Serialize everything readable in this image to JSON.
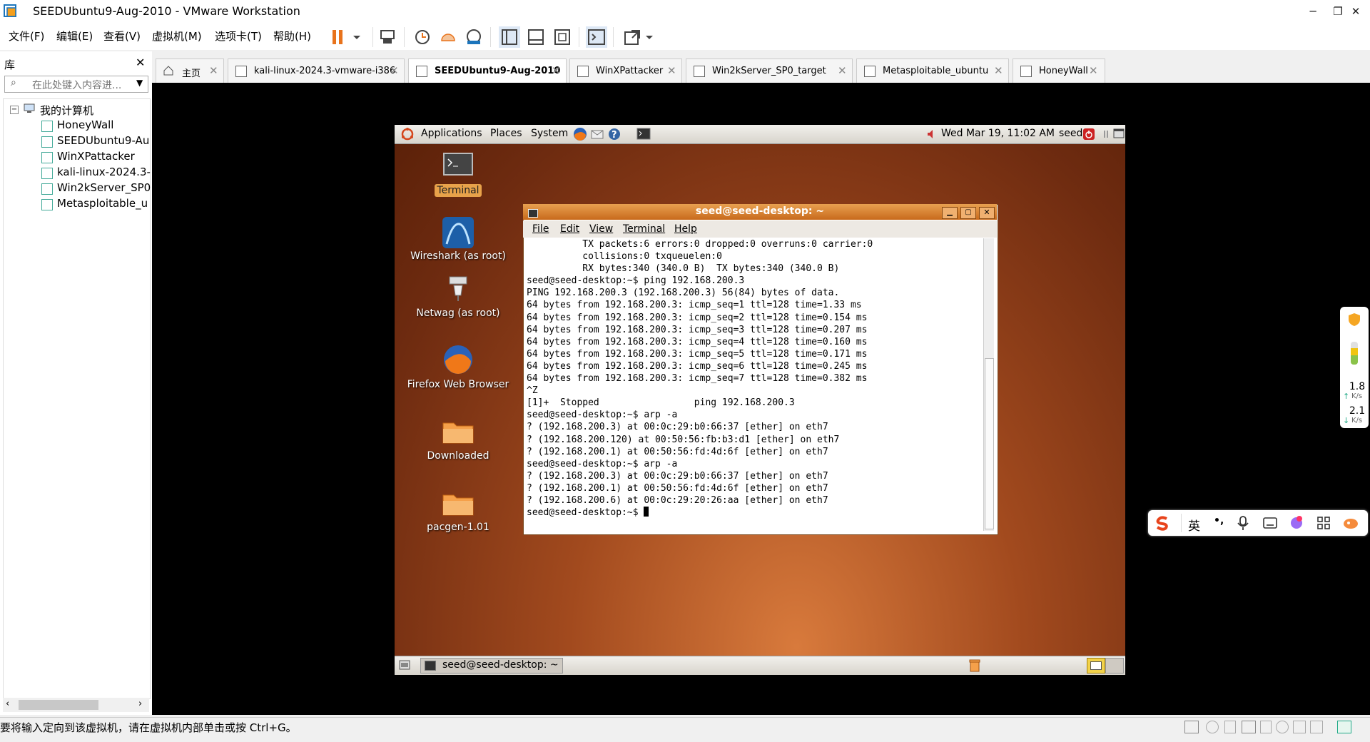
{
  "window": {
    "title": "SEEDUbuntu9-Aug-2010 - VMware Workstation",
    "min": "─",
    "restore": "❐",
    "close": "✕"
  },
  "menubar": {
    "items": [
      "文件(F)",
      "编辑(E)",
      "查看(V)",
      "虚拟机(M)",
      "选项卡(T)",
      "帮助(H)"
    ]
  },
  "library": {
    "title": "库",
    "search_placeholder": "在此处键入内容进...",
    "root": "我的计算机",
    "items": [
      "HoneyWall",
      "SEEDUbuntu9-Au",
      "WinXPattacker",
      "kali-linux-2024.3-",
      "Win2kServer_SP0",
      "Metasploitable_u"
    ]
  },
  "tabs": [
    {
      "label": "主页"
    },
    {
      "label": "kali-linux-2024.3-vmware-i386"
    },
    {
      "label": "SEEDUbuntu9-Aug-2010"
    },
    {
      "label": "WinXPattacker"
    },
    {
      "label": "Win2kServer_SP0_target"
    },
    {
      "label": "Metasploitable_ubuntu"
    },
    {
      "label": "HoneyWall"
    }
  ],
  "guest": {
    "panel": {
      "applications": "Applications",
      "places": "Places",
      "system": "System",
      "datetime": "Wed Mar 19, 11:02 AM",
      "user": "seed"
    },
    "desktop_icons": [
      "Terminal",
      "Wireshark (as root)",
      "Netwag (as root)",
      "Firefox Web Browser",
      "Downloaded",
      "pacgen-1.01"
    ],
    "taskbar_item": "seed@seed-desktop: ~",
    "terminal": {
      "title": "seed@seed-desktop: ~",
      "menu": [
        "File",
        "Edit",
        "View",
        "Terminal",
        "Help"
      ],
      "lines": [
        "          TX packets:6 errors:0 dropped:0 overruns:0 carrier:0",
        "          collisions:0 txqueuelen:0",
        "          RX bytes:340 (340.0 B)  TX bytes:340 (340.0 B)",
        "",
        "seed@seed-desktop:~$ ping 192.168.200.3",
        "PING 192.168.200.3 (192.168.200.3) 56(84) bytes of data.",
        "64 bytes from 192.168.200.3: icmp_seq=1 ttl=128 time=1.33 ms",
        "64 bytes from 192.168.200.3: icmp_seq=2 ttl=128 time=0.154 ms",
        "64 bytes from 192.168.200.3: icmp_seq=3 ttl=128 time=0.207 ms",
        "64 bytes from 192.168.200.3: icmp_seq=4 ttl=128 time=0.160 ms",
        "64 bytes from 192.168.200.3: icmp_seq=5 ttl=128 time=0.171 ms",
        "64 bytes from 192.168.200.3: icmp_seq=6 ttl=128 time=0.245 ms",
        "64 bytes from 192.168.200.3: icmp_seq=7 ttl=128 time=0.382 ms",
        "^Z",
        "[1]+  Stopped                 ping 192.168.200.3",
        "seed@seed-desktop:~$ arp -a",
        "? (192.168.200.3) at 00:0c:29:b0:66:37 [ether] on eth7",
        "? (192.168.200.120) at 00:50:56:fb:b3:d1 [ether] on eth7",
        "? (192.168.200.1) at 00:50:56:fd:4d:6f [ether] on eth7",
        "seed@seed-desktop:~$ arp -a",
        "? (192.168.200.3) at 00:0c:29:b0:66:37 [ether] on eth7",
        "? (192.168.200.1) at 00:50:56:fd:4d:6f [ether] on eth7",
        "? (192.168.200.6) at 00:0c:29:20:26:aa [ether] on eth7",
        "seed@seed-desktop:~$ "
      ]
    }
  },
  "side_widget": {
    "up_speed": "1.8",
    "up_unit": "K/s",
    "down_speed": "2.1",
    "down_unit": "K/s"
  },
  "ime": {
    "lang": "英",
    "punct": "•,"
  },
  "statusbar": {
    "text": "要将输入定向到该虚拟机，请在虚拟机内部单击或按 Ctrl+G。"
  },
  "colors": {
    "accent": "#e87a24",
    "pause": "#e8731c",
    "terminal_title": "#d07828"
  }
}
